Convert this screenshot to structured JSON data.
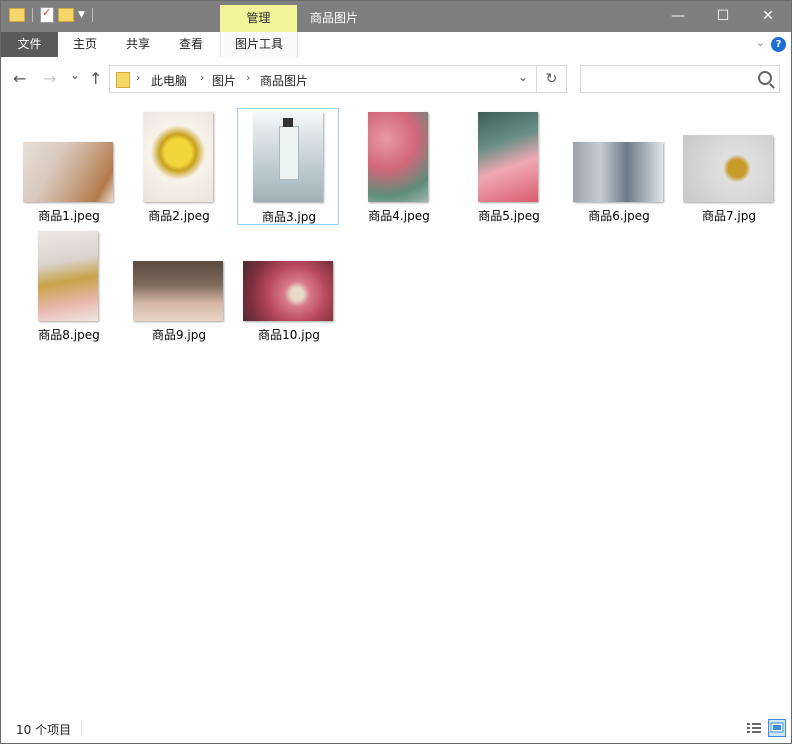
{
  "window": {
    "title": "商品图片",
    "context_tab": "管理",
    "controls": {
      "minimize": "—",
      "maximize": "☐",
      "close": "✕"
    }
  },
  "ribbon": {
    "tabs": [
      {
        "label": "文件",
        "active": true
      },
      {
        "label": "主页"
      },
      {
        "label": "共享"
      },
      {
        "label": "查看"
      },
      {
        "label": "图片工具"
      }
    ],
    "help": "?"
  },
  "nav": {
    "back": "←",
    "forward": "→",
    "recent": "⌄",
    "up": "↑",
    "breadcrumb": [
      "此电脑",
      "图片",
      "商品图片"
    ],
    "refresh": "↻",
    "search_placeholder": ""
  },
  "files": [
    {
      "name": "商品1.jpeg",
      "colors": [
        "#d9c9bf",
        "#c8a588",
        "#e8dfd6",
        "#b37a4c"
      ],
      "icon": "perfume-thumbnail"
    },
    {
      "name": "商品2.jpeg",
      "colors": [
        "#f2d63c",
        "#e9e4db",
        "#c9a11e",
        "#f7f3ea"
      ],
      "icon": "perfume-thumbnail"
    },
    {
      "name": "商品3.jpg",
      "colors": [
        "#c8d4d8",
        "#e6ecee",
        "#9fb2b8",
        "#f5f7f8"
      ],
      "icon": "perfume-thumbnail",
      "selected": true
    },
    {
      "name": "商品4.jpeg",
      "colors": [
        "#d2677a",
        "#9eb9b2",
        "#e89aa3",
        "#5e8d7b"
      ],
      "icon": "perfume-thumbnail"
    },
    {
      "name": "商品5.jpeg",
      "colors": [
        "#d95b6f",
        "#6a8f86",
        "#f0a9b4",
        "#3d5e58"
      ],
      "icon": "perfume-thumbnail"
    },
    {
      "name": "商品6.jpeg",
      "colors": [
        "#9aa3a8",
        "#c5cdd2",
        "#6c7a86",
        "#e2e6e8"
      ],
      "icon": "perfume-thumbnail"
    },
    {
      "name": "商品7.jpg",
      "colors": [
        "#c8c8c8",
        "#e0e0e0",
        "#c79a2a",
        "#f0f0f0"
      ],
      "icon": "perfume-thumbnail"
    },
    {
      "name": "商品8.jpeg",
      "colors": [
        "#d9d3cc",
        "#c9a248",
        "#efe9e3",
        "#e9b9b2"
      ],
      "icon": "perfume-thumbnail"
    },
    {
      "name": "商品9.jpg",
      "colors": [
        "#7e6a5c",
        "#d4b7a7",
        "#5b4b41",
        "#e7d4c6"
      ],
      "icon": "perfume-thumbnail"
    },
    {
      "name": "商品10.jpg",
      "colors": [
        "#b84a5e",
        "#7a2e3b",
        "#d97a8a",
        "#4c2b33"
      ],
      "icon": "perfume-thumbnail"
    }
  ],
  "status": {
    "item_count": "10 个项目"
  }
}
